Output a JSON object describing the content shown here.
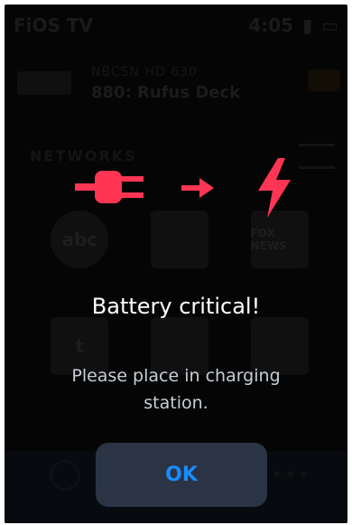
{
  "background_app": {
    "title": "FiOS TV",
    "time": "4:05",
    "now_playing_channel": "NBCSN HD 630",
    "now_playing_title": "880: Rufus Deck",
    "section_label": "NETWORKS",
    "tiles": [
      {
        "label": "abc",
        "icon": "abc-logo"
      },
      {
        "label": "",
        "icon": "channel-logo"
      },
      {
        "label": "FOX NEWS",
        "icon": "fox-news-logo"
      },
      {
        "label": "t",
        "icon": "channel-logo"
      },
      {
        "label": "",
        "icon": "channel-logo"
      },
      {
        "label": "",
        "icon": "channel-logo"
      }
    ]
  },
  "dialog": {
    "icons": [
      "plug-icon",
      "arrow-right-icon",
      "lightning-bolt-icon"
    ],
    "accent_color": "#ff3553",
    "title": "Battery critical!",
    "message": "Please place in charging station.",
    "ok_label": "OK",
    "ok_color": "#1a8cff",
    "button_bg": "#2a3444"
  }
}
